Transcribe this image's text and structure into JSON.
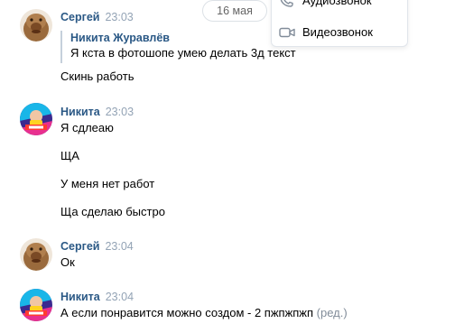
{
  "date_pill": "16 мая",
  "call_menu": {
    "audio_label": "Аудиозвонок",
    "video_label": "Видеозвонок"
  },
  "messages": [
    {
      "author": "Сергей",
      "time": "23:03",
      "quote": {
        "author": "Никита Журавлёв",
        "text": "Я кста в фотошопе умею делать 3д текст"
      },
      "texts": [
        "Скинь работь"
      ]
    },
    {
      "author": "Никита",
      "time": "23:03",
      "texts": [
        "Я сдлеаю",
        "ЩА",
        "У меня нет работ",
        "Ща сделаю быстро"
      ]
    },
    {
      "author": "Сергей",
      "time": "23:04",
      "texts": [
        "Ок"
      ]
    },
    {
      "author": "Никита",
      "time": "23:04",
      "texts": [
        "А если понравится можно создом - 2 пжпжпжп"
      ],
      "edited": "(ред.)"
    }
  ],
  "colors": {
    "author_link": "#2a5885",
    "timestamp": "#93a3b5",
    "quote_bar": "#c5d0db"
  },
  "icons": {
    "audio": "phone-icon",
    "video": "video-camera-icon",
    "avatar_sergey": "alf-avatar",
    "avatar_nikita": "colorful-mrbeast-avatar"
  }
}
